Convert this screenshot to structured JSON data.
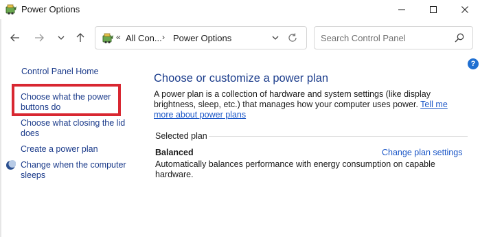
{
  "window": {
    "title": "Power Options",
    "icon": "power-options-icon"
  },
  "nav": {
    "back_icon": "arrow-left-icon",
    "forward_icon": "arrow-right-icon",
    "recent_icon": "chevron-down-icon",
    "up_icon": "arrow-up-icon"
  },
  "address": {
    "chevron": "«",
    "crumb1": "All Con...",
    "separator": "›",
    "crumb2": "Power Options"
  },
  "search": {
    "placeholder": "Search Control Panel"
  },
  "sidebar": {
    "home": "Control Panel Home",
    "items": [
      {
        "label": "Choose what the power buttons do"
      },
      {
        "label": "Choose what closing the lid does"
      },
      {
        "label": "Create a power plan"
      },
      {
        "label": "Change when the computer sleeps"
      }
    ]
  },
  "main": {
    "title": "Choose or customize a power plan",
    "description": "A power plan is a collection of hardware and system settings (like display brightness, sleep, etc.) that manages how your computer uses power. ",
    "learn_more": "Tell me more about power plans",
    "selected_plan_label": "Selected plan",
    "plan": {
      "name": "Balanced",
      "change_link": "Change plan settings",
      "description": "Automatically balances performance with energy consumption on capable hardware."
    }
  },
  "help": {
    "label": "?"
  },
  "colors": {
    "highlight": "#d82731",
    "link": "#1a56c7",
    "title": "#1c3d8c"
  }
}
